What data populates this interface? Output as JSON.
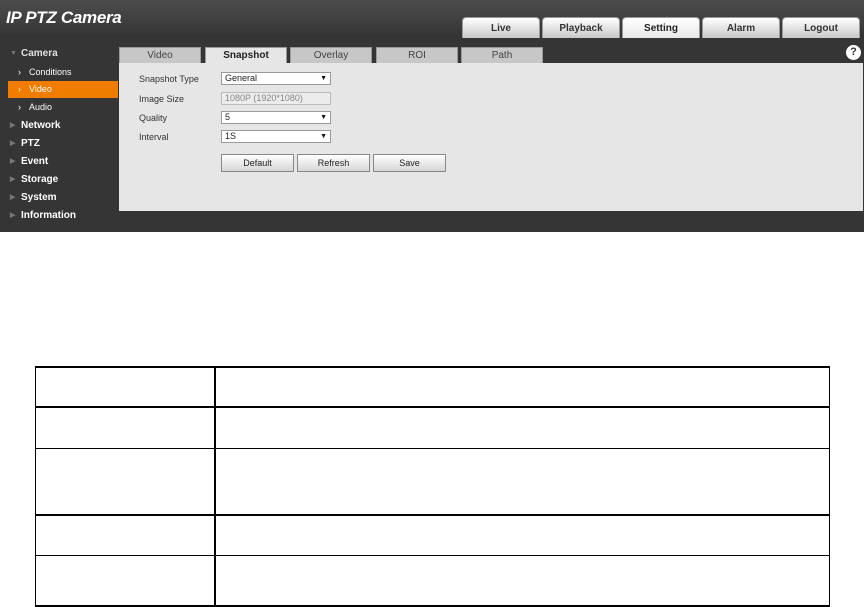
{
  "app": {
    "title": "IP PTZ Camera"
  },
  "top_tabs": [
    {
      "label": "Live",
      "active": false
    },
    {
      "label": "Playback",
      "active": false
    },
    {
      "label": "Setting",
      "active": true
    },
    {
      "label": "Alarm",
      "active": false
    },
    {
      "label": "Logout",
      "active": false
    }
  ],
  "sidebar": {
    "camera": "Camera",
    "sub_items": [
      {
        "label": "Conditions",
        "active": false
      },
      {
        "label": "Video",
        "active": true
      },
      {
        "label": "Audio",
        "active": false
      }
    ],
    "sections": [
      "Network",
      "PTZ",
      "Event",
      "Storage",
      "System",
      "Information"
    ]
  },
  "sub_tabs": [
    {
      "label": "Video",
      "active": false
    },
    {
      "label": "Snapshot",
      "active": true
    },
    {
      "label": "Overlay",
      "active": false
    },
    {
      "label": "ROI",
      "active": false
    },
    {
      "label": "Path",
      "active": false
    }
  ],
  "form": {
    "snapshot_type_label": "Snapshot Type",
    "snapshot_type_value": "General",
    "image_size_label": "Image Size",
    "image_size_value": "1080P (1920*1080)",
    "quality_label": "Quality",
    "quality_value": "5",
    "interval_label": "Interval",
    "interval_value": "1S"
  },
  "buttons": {
    "default": "Default",
    "refresh": "Refresh",
    "save": "Save"
  },
  "help": {
    "glyph": "?"
  },
  "colors": {
    "accent": "#f07c00",
    "panel": "#e6e6e6",
    "chrome": "#353535"
  }
}
